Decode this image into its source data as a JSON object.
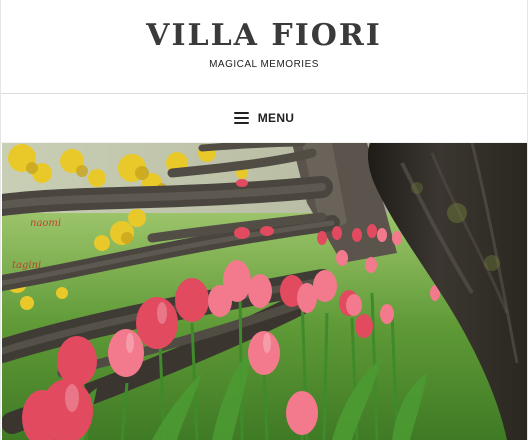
{
  "site": {
    "title": "VILLA FIORI",
    "tagline": "MAGICAL MEMORIES"
  },
  "nav": {
    "menu_label": "MENU",
    "menu_icon": "hamburger-icon"
  },
  "hero": {
    "watermark_line1": "naomi",
    "watermark_line2": "tagini"
  }
}
